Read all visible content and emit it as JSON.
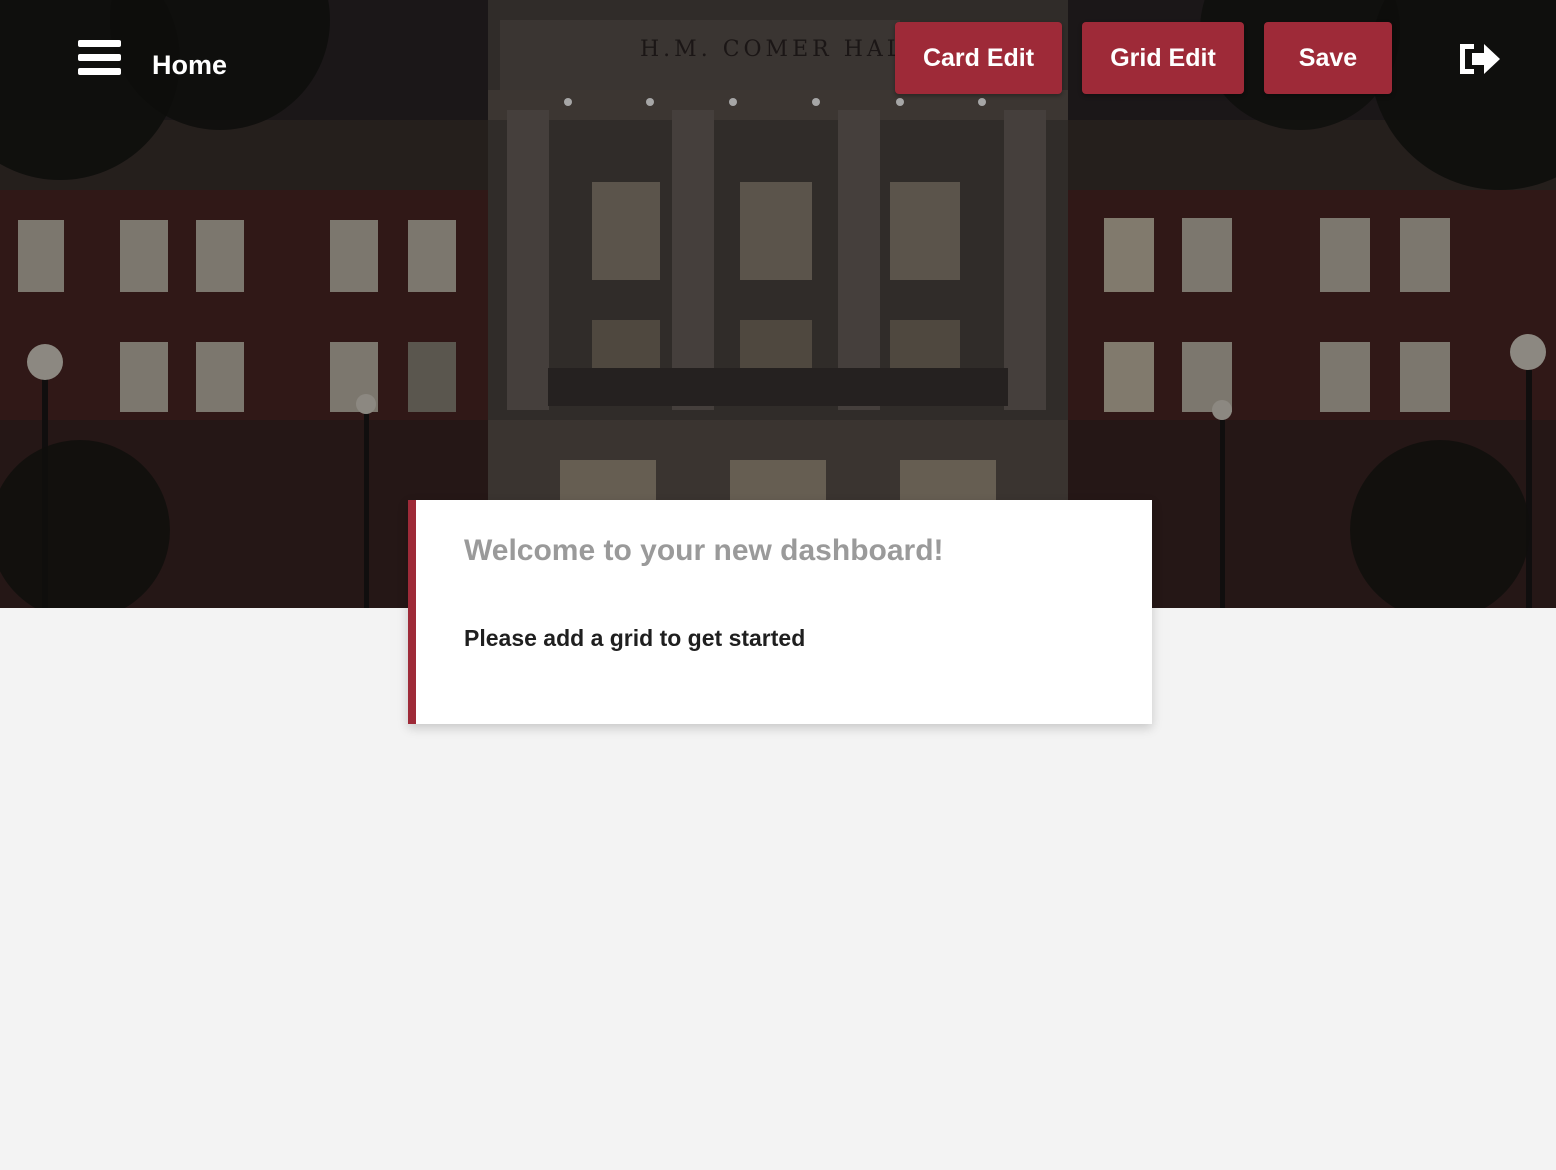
{
  "header": {
    "title": "Home",
    "menu_icon": "hamburger-menu-icon",
    "logout_icon": "sign-out-icon"
  },
  "toolbar": {
    "card_edit_label": "Card Edit",
    "grid_edit_label": "Grid Edit",
    "save_label": "Save"
  },
  "hero": {
    "building_inscription": "H.M. COMER HAL"
  },
  "welcome_card": {
    "title": "Welcome to your new dashboard!",
    "message": "Please add a grid to get started"
  },
  "colors": {
    "accent": "#9e2a38",
    "page_background": "#f3f3f3",
    "card_title": "#9a9a9a"
  }
}
